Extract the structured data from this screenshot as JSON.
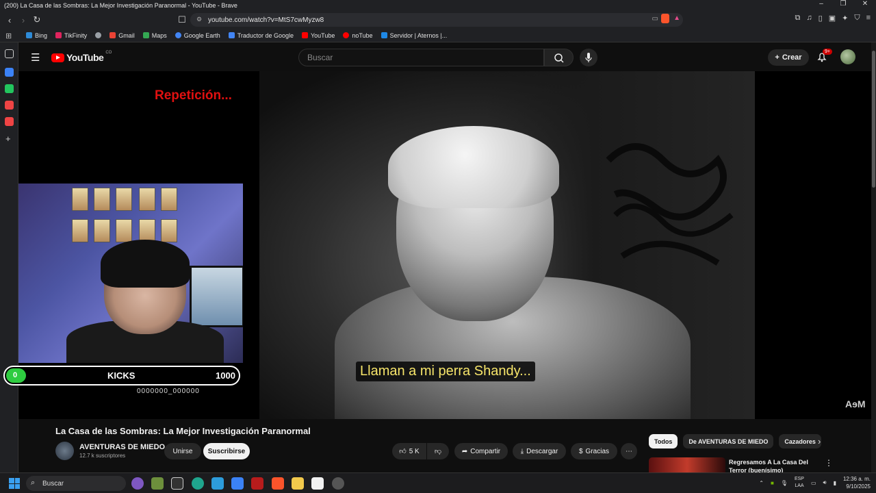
{
  "window": {
    "title": "(200) La Casa de las Sombras: La Mejor Investigación Paranormal - YouTube - Brave",
    "controls": [
      "–",
      "❐",
      "✕"
    ]
  },
  "browser": {
    "url": "youtube.com/watch?v=MtS7cwMyzw8",
    "bookmarks": [
      {
        "label": "Bing",
        "color": "#2e8bd8"
      },
      {
        "label": "TikFinity",
        "color": "#e0245e"
      },
      {
        "label": "",
        "color": "#9aa0a6"
      },
      {
        "label": "Gmail",
        "color": "#ea4335"
      },
      {
        "label": "Maps",
        "color": "#34a853"
      },
      {
        "label": "Google Earth",
        "color": "#4285f4"
      },
      {
        "label": "Traductor de Google",
        "color": "#4285f4"
      },
      {
        "label": "YouTube",
        "color": "#ff0000"
      },
      {
        "label": "noTube",
        "color": "#ff0000"
      },
      {
        "label": "Servidor | Aternos |...",
        "color": "#1e88e5"
      }
    ]
  },
  "youtube": {
    "logo_text": "YouTube",
    "country_code": "CO",
    "search_placeholder": "Buscar",
    "create_label": "Crear",
    "notifications_badge": "9+"
  },
  "video": {
    "replay_text": "Repetición...",
    "subtitle": "Llaman a mi perra Shandy...",
    "watermark": "AɘM",
    "title": "La Casa de las Sombras: La Mejor Investigación Paranormal"
  },
  "overlay": {
    "kicks_current": "0",
    "kicks_label": "KICKS",
    "kicks_goal": "1000",
    "code": "0000000_000000"
  },
  "channel": {
    "name": "AVENTURAS DE MIEDO",
    "subscribers": "12.7 k suscriptores",
    "join_label": "Unirse",
    "subscribe_label": "Suscribirse"
  },
  "actions": {
    "likes": "5 K",
    "share_label": "Compartir",
    "download_label": "Descargar",
    "thanks_label": "Gracias"
  },
  "related": {
    "chips": [
      "Todos",
      "De AVENTURAS DE MIEDO",
      "Cazadores"
    ],
    "first_title": "Regresamos A La Casa Del Terror (buenísimo)"
  },
  "taskbar": {
    "search_placeholder": "Buscar",
    "lang_top": "ESP",
    "lang_bottom": "LAA",
    "time": "12:36 a. m.",
    "date": "9/10/2025"
  }
}
